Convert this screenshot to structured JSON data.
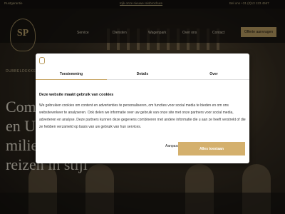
{
  "topbar": {
    "left": "Rustgarantie",
    "center": "Kijk onze nieuwe reisbrochure",
    "right": "Bel ons +31 (0)13 123 4567"
  },
  "nav": {
    "logo": "SP",
    "items": [
      "Service",
      "Diensten",
      "Wagenpark",
      "Over ons",
      "Contact"
    ],
    "cta": "Offerte aanvragen"
  },
  "hero": {
    "small": "DUBBELDEKKER",
    "line1": "Com",
    "line2": "en U",
    "line3": "milie",
    "line4": "reizen in stijl"
  },
  "cookie": {
    "tabs": [
      "Toestemming",
      "Details",
      "Over"
    ],
    "title": "Deze website maakt gebruik van cookies",
    "text": "We gebruiken cookies om content en advertenties te personaliseren, om functies voor social media te bieden en om ons websiteverkeer te analyseren. Ook delen we informatie over uw gebruik van onze site met onze partners voor social media, adverteren en analyse. Deze partners kunnen deze gegevens combineren met andere informatie die u aan ze heeft verstrekt of die ze hebben verzameld op basis van uw gebruik van hun services.",
    "customize": "Aanpassen  ›",
    "allow": "Alles toestaan"
  },
  "colors": {
    "accent": "#c9a96a"
  }
}
